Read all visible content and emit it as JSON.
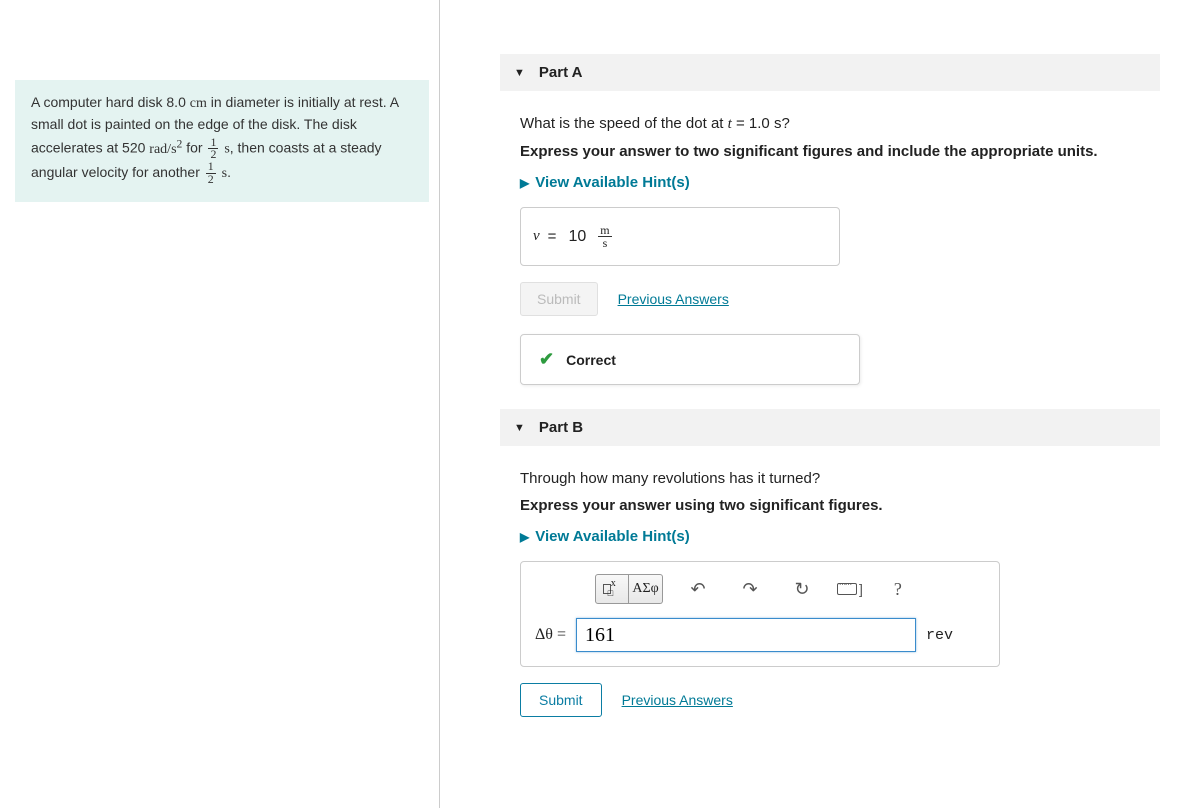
{
  "problem": {
    "line1a": "A computer hard disk 8.0 ",
    "line1_unit": "cm",
    "line1b": " in diameter is initially at rest. A small dot is painted on the edge of the disk. The disk accelerates at 520 ",
    "accel_unit": "rad/s",
    "line1c": " for ",
    "frac_num": "1",
    "frac_den": "2",
    "line1d": ", then coasts at a steady angular velocity for another ",
    "frac2_num": "1",
    "frac2_den": "2",
    "s_label": "s",
    "period": "."
  },
  "partA": {
    "header": "Part A",
    "question_a": "What is the speed of the dot at ",
    "question_var": "t",
    "question_b": " = 1.0 ",
    "question_unit": "s",
    "question_c": "?",
    "instruction": "Express your answer to two significant figures and include the appropriate units.",
    "hints": "View Available Hint(s)",
    "lhs": "v",
    "eq": " = ",
    "value": "10",
    "unit_num": "m",
    "unit_den": "s",
    "submit": "Submit",
    "prev": "Previous Answers",
    "correct": "Correct"
  },
  "partB": {
    "header": "Part B",
    "question": "Through how many revolutions has it turned?",
    "instruction": "Express your answer using two significant figures.",
    "hints": "View Available Hint(s)",
    "toolbar": {
      "template": "▭",
      "root": "√▭",
      "greek": "ΑΣφ",
      "undo": "↶",
      "redo": "↷",
      "reset": "↻",
      "keyboard": "▦]",
      "help": "?"
    },
    "lhs": "Δθ = ",
    "value": "161",
    "unit": "rev",
    "submit": "Submit",
    "prev": "Previous Answers"
  }
}
